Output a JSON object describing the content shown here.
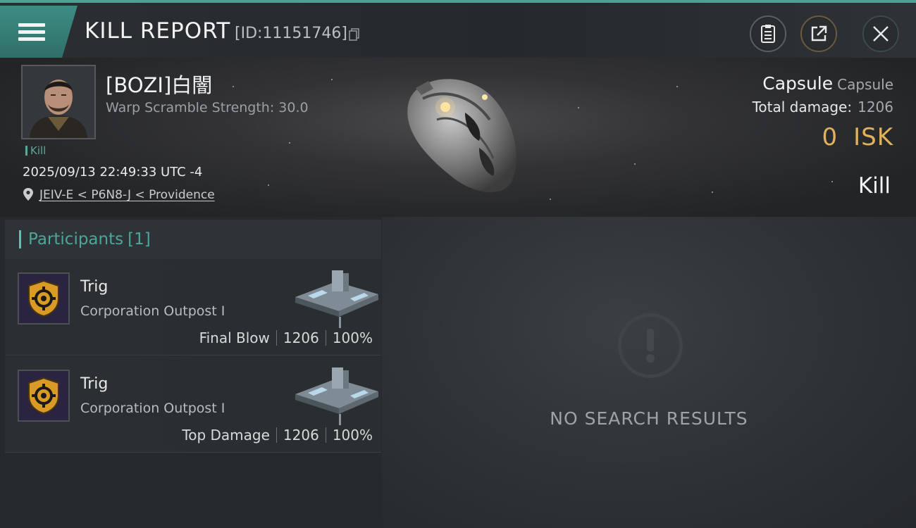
{
  "header": {
    "title": "KILL REPORT",
    "report_id": "[ID:11151746]",
    "icons": [
      "menu-icon",
      "copy-icon",
      "clipboard-icon",
      "share-icon",
      "close-icon"
    ]
  },
  "victim": {
    "name": "[BOZI]白闇",
    "subtitle": "Warp Scramble Strength: 30.0",
    "tag": "Kill",
    "datetime": "2025/09/13 22:49:33 UTC -4",
    "location": "JEIV-E < P6N8-J < Providence"
  },
  "summary": {
    "ship_name": "Capsule",
    "ship_class": "Capsule",
    "total_damage_label": "Total damage:",
    "total_damage_value": "1206",
    "isk_value": "0",
    "isk_unit": "ISK",
    "result": "Kill"
  },
  "participants": {
    "label": "Participants",
    "count": "[1]",
    "items": [
      {
        "name": "Trig",
        "ship": "Corporation Outpost I",
        "role": "Final Blow",
        "damage": "1206",
        "percent": "100%"
      },
      {
        "name": "Trig",
        "ship": "Corporation Outpost I",
        "role": "Top Damage",
        "damage": "1206",
        "percent": "100%"
      }
    ]
  },
  "results": {
    "empty_text": "NO SEARCH RESULTS"
  },
  "colors": {
    "accent_teal": "#4aa79a",
    "isk_gold": "#e2b15c",
    "top_border": "#4f9f95"
  }
}
